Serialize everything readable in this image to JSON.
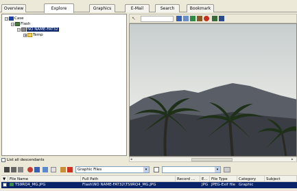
{
  "tabs": [
    "Overview",
    "Explore",
    "Graphics",
    "E-Mail",
    "Search",
    "Bookmark"
  ],
  "active_tab": "Explore",
  "tree": {
    "case": "Case",
    "flash": "Flash",
    "volume": "NO NAME-FAT32",
    "temp": "Temp"
  },
  "list_all_descendants_label": "List all descendants",
  "filter_combo": "Graphic Files",
  "table": {
    "columns": [
      "File Name",
      "Full Path",
      "Record ...",
      "E...",
      "File Type",
      "Category",
      "Subject"
    ],
    "rows": [
      {
        "file_name": "TS9RQ4_MG.JPG",
        "full_path": "Flash\\NO NAME-FAT32\\TS9RQ4_MG.JPG",
        "record": "",
        "ext": "JPG",
        "file_type": "JPEG-Exif file",
        "category": "Graphic",
        "subject": ""
      }
    ]
  },
  "colors": {
    "selection": "#0a246a",
    "panel_bg": "#ece9d8",
    "sky_top": "#a8b4b8",
    "mountain": "#5c6068"
  },
  "icons": [
    "minus-icon",
    "plus-icon",
    "case-icon",
    "drive-icon",
    "folder-icon",
    "pointer-icon",
    "zoom-icon",
    "rotate-icon",
    "image-icon"
  ]
}
